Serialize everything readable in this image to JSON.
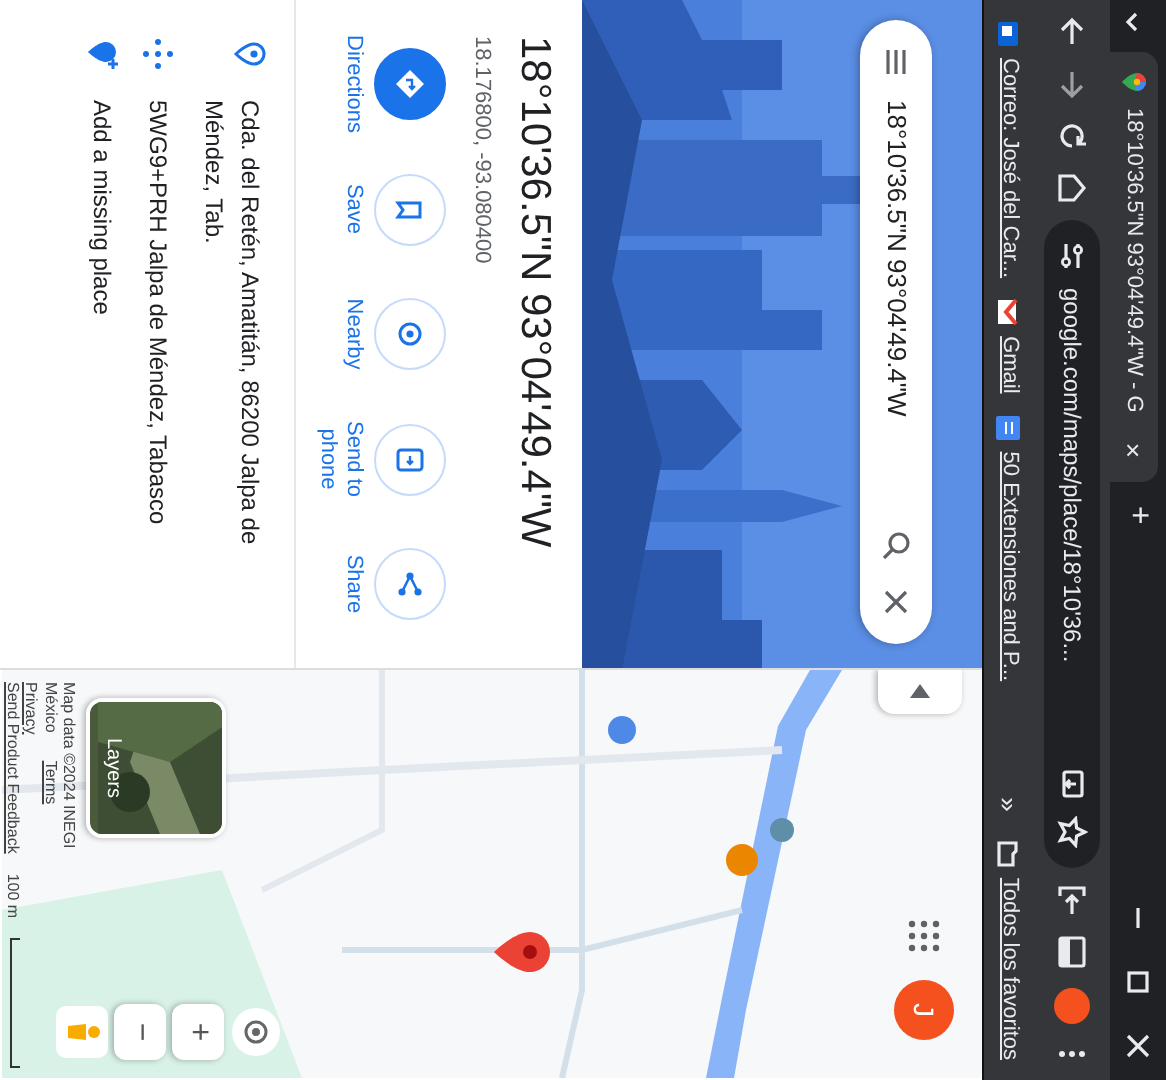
{
  "browser": {
    "tab": {
      "title": "18°10'36.5\"N 93°04'49.4\"W - G",
      "close": "×",
      "selected": true
    },
    "new_tab": "+",
    "address": "google.com/maps/place/18°10'36...",
    "bookmarks": [
      {
        "label": "Correo: José del Car...",
        "kind": "mail"
      },
      {
        "label": "Gmail",
        "kind": "gmail"
      },
      {
        "label": "50 Extensiones and P...",
        "kind": "doc"
      }
    ],
    "more_bookmarks": "»",
    "all_bookmarks": "Todos los favoritos"
  },
  "search": {
    "value": "18°10'36.5\"N 93°04'49.4\"W"
  },
  "place": {
    "title": "18°10'36.5\"N 93°04'49.4\"W",
    "coordinates": "18.176800, -93.080400"
  },
  "actions": [
    {
      "label": "Directions",
      "kind": "directions",
      "filled": true
    },
    {
      "label": "Save",
      "kind": "save",
      "filled": false
    },
    {
      "label": "Nearby",
      "kind": "nearby",
      "filled": false
    },
    {
      "label": "Send to phone",
      "kind": "phone",
      "filled": false
    },
    {
      "label": "Share",
      "kind": "share",
      "filled": false
    }
  ],
  "details": [
    {
      "kind": "address",
      "text": "Cda. del Retén, Amatitán, 86200 Jalpa de Méndez, Tab."
    },
    {
      "kind": "plus_code",
      "text": "5WG9+PRH Jalpa de Méndez, Tabasco"
    },
    {
      "kind": "add_place",
      "text": "Add a missing place"
    }
  ],
  "map": {
    "account_initial": "J",
    "layers_label": "Layers",
    "zoom_in": "+",
    "zoom_out": "−",
    "footer": [
      "Map data ©2024 INEGI",
      "México",
      "Terms",
      "Privacy",
      "Send Product Feedback"
    ],
    "scale": "100 m"
  }
}
